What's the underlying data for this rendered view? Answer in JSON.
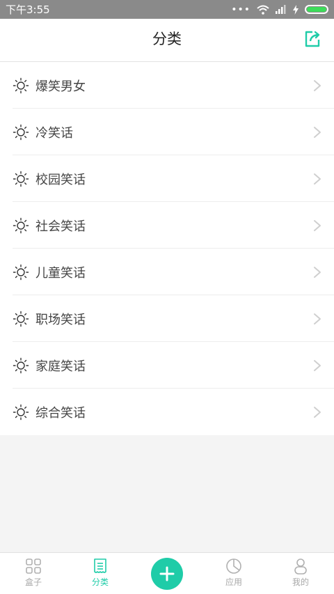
{
  "status_bar": {
    "time": "下午3:55",
    "dots": "•••"
  },
  "header": {
    "title": "分类",
    "share_icon": "share-icon"
  },
  "categories": [
    {
      "label": "爆笑男女"
    },
    {
      "label": "冷笑话"
    },
    {
      "label": "校园笑话"
    },
    {
      "label": "社会笑话"
    },
    {
      "label": "儿童笑话"
    },
    {
      "label": "职场笑话"
    },
    {
      "label": "家庭笑话"
    },
    {
      "label": "综合笑话"
    }
  ],
  "bottom_nav": {
    "items": [
      {
        "label": "盒子",
        "icon": "grid-icon"
      },
      {
        "label": "分类",
        "icon": "document-icon"
      },
      {
        "label": "",
        "icon": "plus-icon"
      },
      {
        "label": "应用",
        "icon": "pie-chart-icon"
      },
      {
        "label": "我的",
        "icon": "user-icon"
      }
    ]
  },
  "colors": {
    "accent": "#1fcca8",
    "status_bar": "#8a8a8a",
    "inactive": "#a8a8a8"
  }
}
